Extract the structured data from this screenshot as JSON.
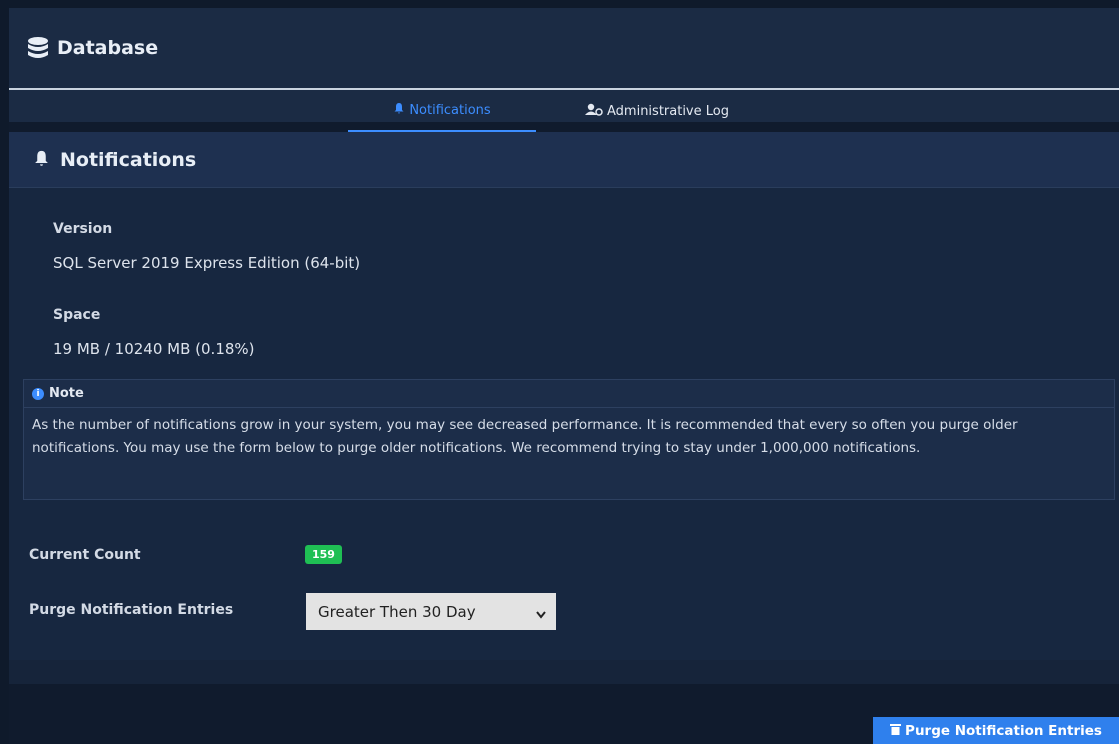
{
  "header": {
    "title": "Database",
    "icon": "database-icon"
  },
  "tabs": [
    {
      "label": "Notifications",
      "icon": "bell-icon",
      "active": true
    },
    {
      "label": "Administrative Log",
      "icon": "user-admin-icon",
      "active": false
    }
  ],
  "section": {
    "title": "Notifications",
    "icon": "bell-icon"
  },
  "info": {
    "version_label": "Version",
    "version_value": "SQL Server 2019 Express Edition (64-bit)",
    "space_label": "Space",
    "space_value": "19 MB / 10240 MB (0.18%)"
  },
  "note": {
    "title": "Note",
    "text": "As the number of notifications grow in your system, you may see decreased performance. It is recommended that every so often you purge older notifications. You may use the form below to purge older notifications. We recommend trying to stay under 1,000,000 notifications."
  },
  "form": {
    "count_label": "Current Count",
    "count_value": "159",
    "purge_label": "Purge Notification Entries",
    "purge_selected": "Greater Then 30 Day"
  },
  "actions": {
    "purge_button": "Purge Notification Entries"
  },
  "colors": {
    "accent": "#3c8dff",
    "badge": "#1fbf54",
    "button": "#2f80ed"
  }
}
